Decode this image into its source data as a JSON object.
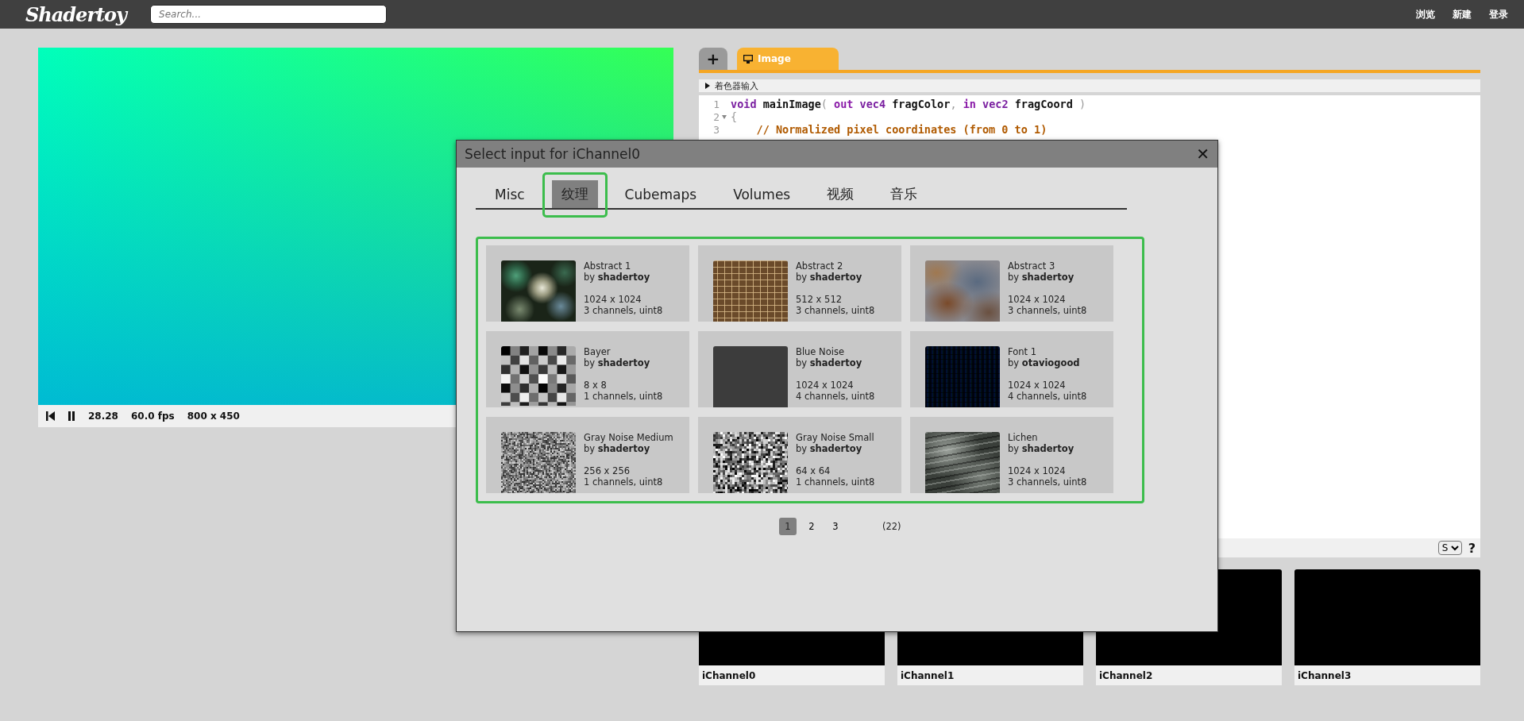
{
  "top_bar": {
    "logo": "Shadertoy",
    "search": {
      "placeholder": "Search..."
    },
    "nav": [
      "浏览",
      "新建",
      "登录"
    ]
  },
  "player": {
    "time": "28.28",
    "fps": "60.0 fps",
    "resolution": "800 x 450"
  },
  "editor": {
    "add_label": "+",
    "tabs": [
      {
        "label": "Image",
        "selected": true
      }
    ],
    "inputs_toggle": "着色器输入",
    "code_lines": [
      {
        "number": "1",
        "foldable": false,
        "tokens": [
          {
            "text": "void",
            "kind": "type"
          },
          {
            "text": " mainImage",
            "kind": "plain"
          },
          {
            "text": "( ",
            "kind": "punct"
          },
          {
            "text": "out",
            "kind": "keyword"
          },
          {
            "text": " vec4",
            "kind": "type"
          },
          {
            "text": " fragColor",
            "kind": "plain"
          },
          {
            "text": ", ",
            "kind": "punct"
          },
          {
            "text": "in",
            "kind": "keyword"
          },
          {
            "text": " vec2",
            "kind": "type"
          },
          {
            "text": " fragCoord",
            "kind": "plain"
          },
          {
            "text": " )",
            "kind": "punct"
          }
        ]
      },
      {
        "number": "2",
        "foldable": true,
        "tokens": [
          {
            "text": "{",
            "kind": "punct"
          }
        ]
      },
      {
        "number": "3",
        "foldable": false,
        "tokens": [
          {
            "text": "    // Normalized pixel coordinates (from 0 to 1)",
            "kind": "comment"
          }
        ]
      }
    ],
    "mode_select": "S",
    "help": "?"
  },
  "channels": [
    "iChannel0",
    "iChannel1",
    "iChannel2",
    "iChannel3"
  ],
  "dialog": {
    "title": "Select input for iChannel0",
    "close": "✕",
    "tabs": [
      {
        "label": "Misc",
        "selected": false,
        "highlighted": false
      },
      {
        "label": "纹理",
        "selected": true,
        "highlighted": true
      },
      {
        "label": "Cubemaps",
        "selected": false,
        "highlighted": false
      },
      {
        "label": "Volumes",
        "selected": false,
        "highlighted": false
      },
      {
        "label": "视频",
        "selected": false,
        "highlighted": false
      },
      {
        "label": "音乐",
        "selected": false,
        "highlighted": false
      }
    ],
    "grid_highlighted": true,
    "textures": [
      {
        "name": "Abstract 1",
        "author": "by **shadertoy**",
        "size": "1024 x 1024",
        "format": "3 channels, uint8",
        "kind": "pebbles"
      },
      {
        "name": "Abstract 2",
        "author": "by **shadertoy**",
        "size": "512 x 512",
        "format": "3 channels, uint8",
        "kind": "fibers"
      },
      {
        "name": "Abstract 3",
        "author": "by **shadertoy**",
        "size": "1024 x 1024",
        "format": "3 channels, uint8",
        "kind": "rock"
      },
      {
        "name": "Bayer",
        "author": "by **shadertoy**",
        "size": "8 x 8",
        "format": "1 channels, uint8",
        "kind": "checker"
      },
      {
        "name": "Blue Noise",
        "author": "by **shadertoy**",
        "size": "1024 x 1024",
        "format": "4 channels, uint8",
        "kind": "solid"
      },
      {
        "name": "Font 1",
        "author": "by **otaviogood**",
        "size": "1024 x 1024",
        "format": "4 channels, uint8",
        "kind": "glyphs"
      },
      {
        "name": "Gray Noise Medium",
        "author": "by **shadertoy**",
        "size": "256 x 256",
        "format": "1 channels, uint8",
        "kind": "noise-fine"
      },
      {
        "name": "Gray Noise Small",
        "author": "by **shadertoy**",
        "size": "64 x 64",
        "format": "1 channels, uint8",
        "kind": "noise-coarse"
      },
      {
        "name": "Lichen",
        "author": "by **shadertoy**",
        "size": "1024 x 1024",
        "format": "3 channels, uint8",
        "kind": "bark"
      }
    ],
    "pages": [
      {
        "label": "1",
        "selected": true
      },
      {
        "label": "2",
        "selected": false
      },
      {
        "label": "3",
        "selected": false
      }
    ],
    "total": "(22)"
  }
}
